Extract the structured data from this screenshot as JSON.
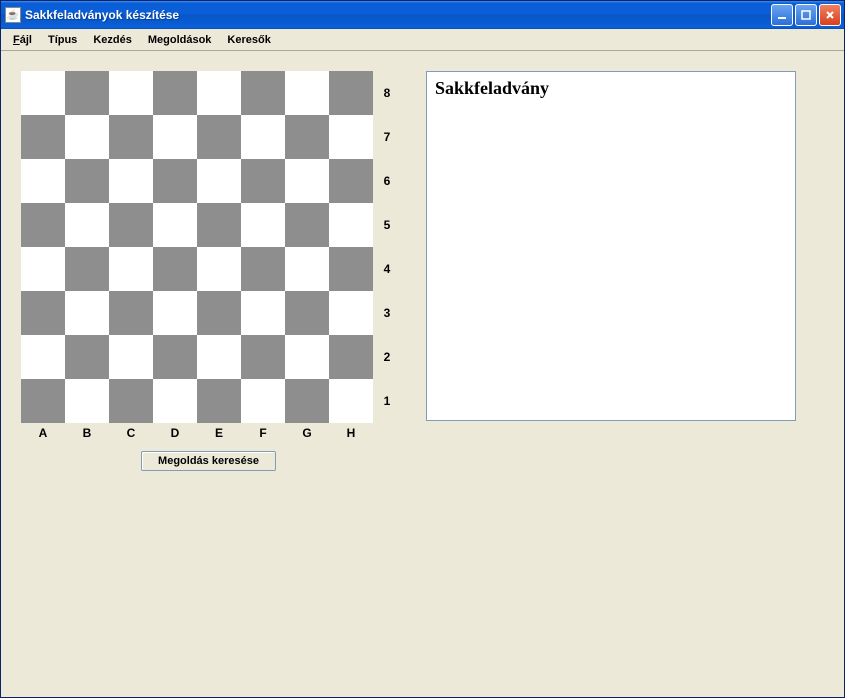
{
  "window": {
    "title": "Sakkfeladványok készítése"
  },
  "menu": {
    "file": "Fájl",
    "type": "Típus",
    "start": "Kezdés",
    "solutions": "Megoldások",
    "searchers": "Keresők"
  },
  "board": {
    "files": [
      "A",
      "B",
      "C",
      "D",
      "E",
      "F",
      "G",
      "H"
    ],
    "ranks": [
      "8",
      "7",
      "6",
      "5",
      "4",
      "3",
      "2",
      "1"
    ]
  },
  "buttons": {
    "solve": "Megoldás keresése"
  },
  "panel": {
    "title": "Sakkfeladvány"
  }
}
